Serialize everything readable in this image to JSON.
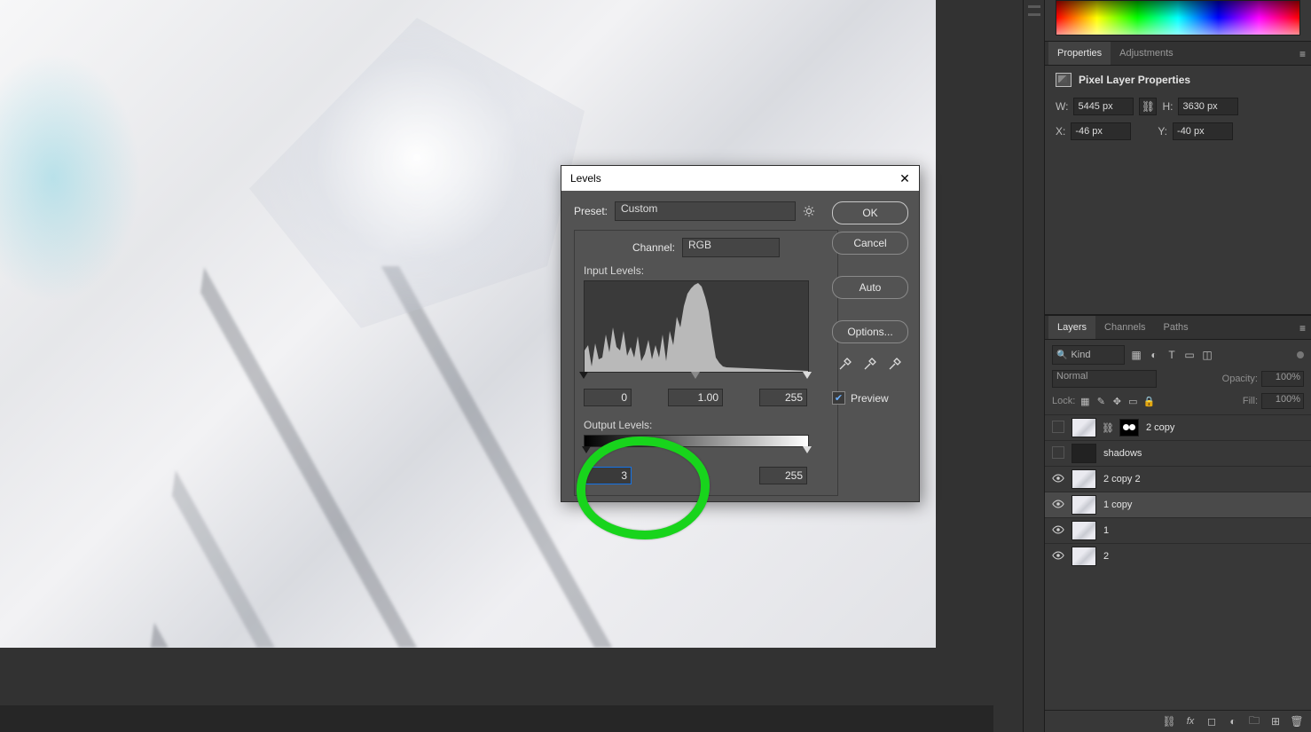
{
  "dialog": {
    "title": "Levels",
    "preset_label": "Preset:",
    "preset_value": "Custom",
    "channel_label": "Channel:",
    "channel_value": "RGB",
    "input_levels_label": "Input Levels:",
    "output_levels_label": "Output Levels:",
    "input_black": "0",
    "input_gamma": "1.00",
    "input_white": "255",
    "output_black": "3",
    "output_white": "255",
    "ok": "OK",
    "cancel": "Cancel",
    "auto": "Auto",
    "options": "Options...",
    "preview_label": "Preview",
    "preview_checked": true
  },
  "properties": {
    "tab_properties": "Properties",
    "tab_adjustments": "Adjustments",
    "header": "Pixel Layer Properties",
    "W_label": "W:",
    "H_label": "H:",
    "X_label": "X:",
    "Y_label": "Y:",
    "W": "5445 px",
    "H": "3630 px",
    "X": "-46 px",
    "Y": "-40 px"
  },
  "layers_panel": {
    "tab_layers": "Layers",
    "tab_channels": "Channels",
    "tab_paths": "Paths",
    "kind_label": "Kind",
    "blend_mode": "Normal",
    "opacity_label": "Opacity:",
    "opacity_value": "100%",
    "lock_label": "Lock:",
    "fill_label": "Fill:",
    "fill_value": "100%",
    "search_placeholder": "Kind",
    "layers": [
      {
        "name": "2 copy",
        "visible": false,
        "selected": false,
        "has_mask": true
      },
      {
        "name": "shadows",
        "visible": false,
        "selected": false,
        "has_mask": false
      },
      {
        "name": "2 copy 2",
        "visible": true,
        "selected": false,
        "has_mask": false
      },
      {
        "name": "1 copy",
        "visible": true,
        "selected": true,
        "has_mask": false
      },
      {
        "name": "1",
        "visible": true,
        "selected": false,
        "has_mask": false
      },
      {
        "name": "2",
        "visible": true,
        "selected": false,
        "has_mask": false
      }
    ]
  },
  "icons": {
    "filter_image": "▦",
    "filter_adjust": "◐",
    "filter_type": "T",
    "filter_shape": "▭",
    "filter_smart": "◫",
    "lock_trans": "▦",
    "lock_paint": "✎",
    "lock_move": "✥",
    "lock_nest": "▭",
    "lock_all": "🔒",
    "footer_link": "⛓",
    "footer_fx": "fx",
    "footer_mask": "◻",
    "footer_adj": "◐",
    "footer_group": "🗀",
    "footer_new": "⊞",
    "footer_trash": "🗑"
  }
}
